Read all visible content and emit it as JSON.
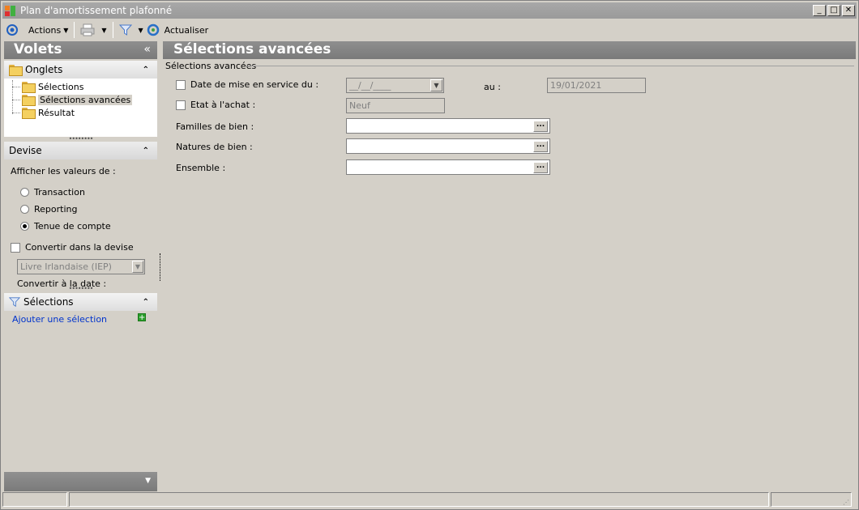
{
  "window": {
    "title": "Plan d'amortissement plafonné",
    "minimize": "_",
    "maximize": "□",
    "close": "✕"
  },
  "toolbar": {
    "actions_label": "Actions",
    "refresh_label": "Actualiser"
  },
  "left_panel": {
    "title": "Volets",
    "collapse_glyph": "«",
    "tabs_section": {
      "title": "Onglets",
      "items": [
        {
          "label": "Sélections"
        },
        {
          "label": "Sélections avancées"
        },
        {
          "label": "Résultat"
        }
      ],
      "selected_index": 1
    },
    "devise_section": {
      "title": "Devise",
      "show_values_label": "Afficher les valeurs de :",
      "options": [
        {
          "label": "Transaction",
          "checked": false
        },
        {
          "label": "Reporting",
          "checked": false
        },
        {
          "label": "Tenue de compte",
          "checked": true
        }
      ],
      "convert_label": "Convertir dans la devise",
      "currency_value": "Livre Irlandaise (IEP)",
      "convert_date_label": "Convertir à la date :"
    },
    "selections_section": {
      "title": "Sélections",
      "add_link": "Ajouter une sélection"
    }
  },
  "main": {
    "title": "Sélections avancées",
    "group_label": "Sélections avancées",
    "fields": {
      "date_service_label": "Date de mise en service du :",
      "date_service_value": "__/__/____",
      "date_to_label": "au :",
      "date_to_value": "19/01/2021",
      "etat_label": "Etat à l'achat :",
      "etat_value": "Neuf",
      "familles_label": "Familles de bien :",
      "natures_label": "Natures de bien :",
      "ensemble_label": "Ensemble :",
      "ellipsis": "..."
    }
  },
  "colors": {
    "chrome": "#d4d0c8",
    "header_gray": "#8e8e8e",
    "link_blue": "#0033cc"
  }
}
